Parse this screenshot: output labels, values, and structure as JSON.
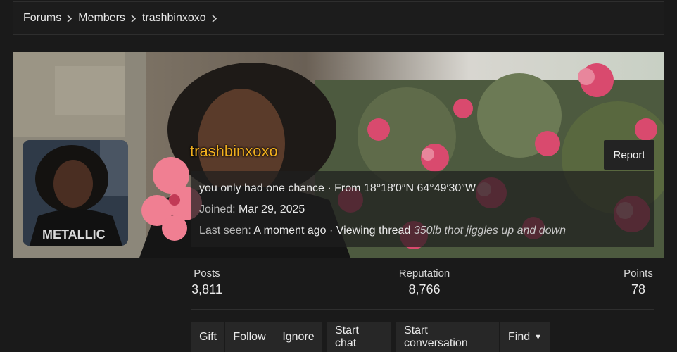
{
  "breadcrumb": {
    "items": [
      "Forums",
      "Members",
      "trashbinxoxo"
    ]
  },
  "profile": {
    "username": "trashbinxoxo",
    "username_color": "#f2b01e",
    "report_label": "Report",
    "tagline": "you only had one chance",
    "location_prefix": "From",
    "location": "18°18′0″N 64°49′30″W",
    "joined_label": "Joined:",
    "joined_value": "Mar 29, 2025",
    "last_seen_label": "Last seen:",
    "last_seen_value": "A moment ago",
    "activity_label": "Viewing thread",
    "activity_thread": "350lb thot jiggles up and down",
    "separator": "·"
  },
  "stats": {
    "posts_label": "Posts",
    "posts_value": "3,811",
    "reputation_label": "Reputation",
    "reputation_value": "8,766",
    "points_label": "Points",
    "points_value": "78"
  },
  "actions": {
    "gift": "Gift",
    "follow": "Follow",
    "ignore": "Ignore",
    "start_chat": "Start chat",
    "start_conversation": "Start conversation",
    "find": "Find"
  },
  "icons": {
    "breadcrumb_separator": "chevron-right-icon",
    "find_dropdown": "caret-down-icon"
  }
}
